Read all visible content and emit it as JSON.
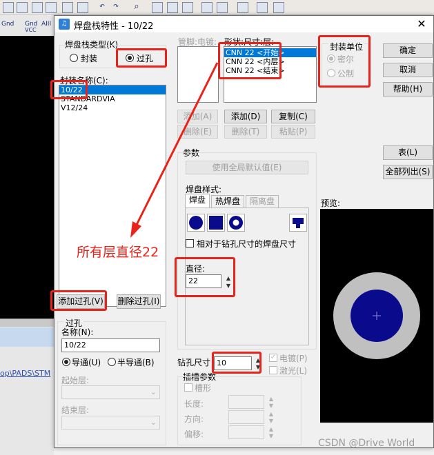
{
  "background": {
    "toolbar_icons": [
      "Gnd",
      "VCC",
      "AIII"
    ],
    "path_text": "op\\PADS\\STM"
  },
  "dialog": {
    "title": "焊盘栈特性 - 10/22",
    "close_symbol": "✕",
    "padstack_type": {
      "label": "焊盘栈类型(K)",
      "options": [
        "封装",
        "过孔"
      ],
      "selected": "过孔"
    },
    "package_name_label": "封装名称(C):",
    "package_list": [
      "10/22",
      "STANDARDVIA",
      "V12/24"
    ],
    "selected_package": "10/22",
    "pin_label": "管脚:电镀:",
    "shape_label": "形状:尺寸:层:",
    "layer_list": [
      "CNN 22 <开始>",
      "CNN 22 <内层>",
      "CNN 22 <结束>"
    ],
    "units": {
      "label": "封装单位",
      "options": [
        "密尔",
        "公制"
      ],
      "selected": "密尔"
    },
    "buttons": {
      "ok": "确定",
      "cancel": "取消",
      "help": "帮助(H)",
      "table": "表(L)",
      "list_all": "全部列出(S)",
      "add_pin": "添加(A)",
      "delete_pin": "删除(E)",
      "add_layer": "添加(D)",
      "copy": "复制(C)",
      "delete_layer": "删除(T)",
      "paste": "粘贴(P)",
      "add_via": "添加过孔(V)",
      "delete_via": "删除过孔(I)",
      "use_global": "使用全局默认值(E)"
    },
    "params": {
      "label": "参数",
      "pad_style_label": "焊盘样式:",
      "tabs": [
        "焊盘",
        "热焊盘",
        "隔离盘"
      ],
      "relative_label": "相对于钻孔尺寸的焊盘尺寸",
      "diameter_label": "直径:",
      "diameter_value": "22"
    },
    "preview_label": "预览:",
    "annotation": "所有层直径22",
    "via": {
      "group_label": "过孔",
      "name_label": "名称(N):",
      "name_value": "10/22",
      "through_label": "导通(U)",
      "partial_label": "半导通(B)",
      "start_layer_label": "起始层:",
      "end_layer_label": "结束层:"
    },
    "drill": {
      "size_label": "钻孔尺寸",
      "size_value": "10",
      "plated_label": "电镀(P)",
      "laser_label": "激光(L)",
      "plated_checked": true
    },
    "slot": {
      "label": "插槽参数",
      "slotted_label": "槽形",
      "length_label": "长度:",
      "direction_label": "方向:",
      "offset_label": "偏移:"
    },
    "colors": {
      "accent": "#e8231a",
      "selection": "#0078d7",
      "pad_blue": "#0a0a8c",
      "pad_gray": "#c0c0c0"
    }
  },
  "watermark": "CSDN @Drive World"
}
